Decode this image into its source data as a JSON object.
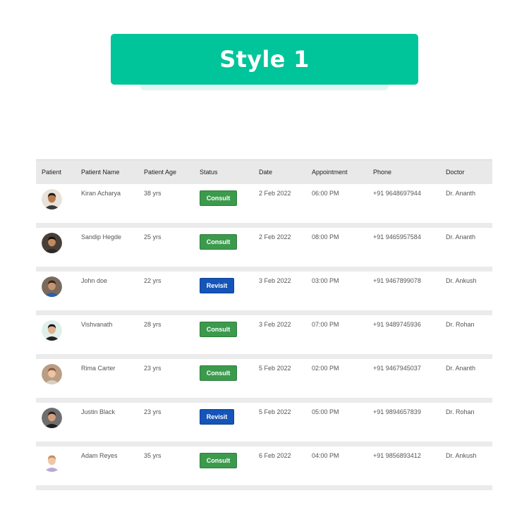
{
  "banner": {
    "title": "Style 1",
    "color": "#00c49a"
  },
  "table": {
    "headers": [
      "Patient",
      "Patient Name",
      "Patient Age",
      "Status",
      "Date",
      "Appointment",
      "Phone",
      "Doctor"
    ],
    "rows": [
      {
        "name": "Kiran Acharya",
        "age": "38 yrs",
        "status": "Consult",
        "date": "2 Feb 2022",
        "time": "06:00 PM",
        "phone": "+91 9648697944",
        "doctor": "Dr. Ananth"
      },
      {
        "name": "Sandip Hegde",
        "age": "25 yrs",
        "status": "Consult",
        "date": "2 Feb 2022",
        "time": "08:00 PM",
        "phone": "+91 9465957584",
        "doctor": "Dr. Ananth"
      },
      {
        "name": "John doe",
        "age": "22 yrs",
        "status": "Revisit",
        "date": "3 Feb 2022",
        "time": "03:00 PM",
        "phone": "+91 9467899078",
        "doctor": "Dr. Ankush"
      },
      {
        "name": "Vishvanath",
        "age": "28 yrs",
        "status": "Consult",
        "date": "3 Feb 2022",
        "time": "07:00 PM",
        "phone": "+91 9489745936",
        "doctor": "Dr. Rohan"
      },
      {
        "name": "Rima Carter",
        "age": "23 yrs",
        "status": "Consult",
        "date": "5 Feb 2022",
        "time": "02:00 PM",
        "phone": "+91 9467945037",
        "doctor": "Dr. Ananth"
      },
      {
        "name": "Justin Black",
        "age": "23 yrs",
        "status": "Revisit",
        "date": "5 Feb 2022",
        "time": "05:00 PM",
        "phone": "+91 9894657839",
        "doctor": "Dr. Rohan"
      },
      {
        "name": "Adam Reyes",
        "age": "35 yrs",
        "status": "Consult",
        "date": "6 Feb 2022",
        "time": "04:00 PM",
        "phone": "+91 9856893412",
        "doctor": "Dr. Ankush"
      }
    ],
    "status_colors": {
      "Consult": "#3c9a4d",
      "Revisit": "#1554b8"
    }
  }
}
